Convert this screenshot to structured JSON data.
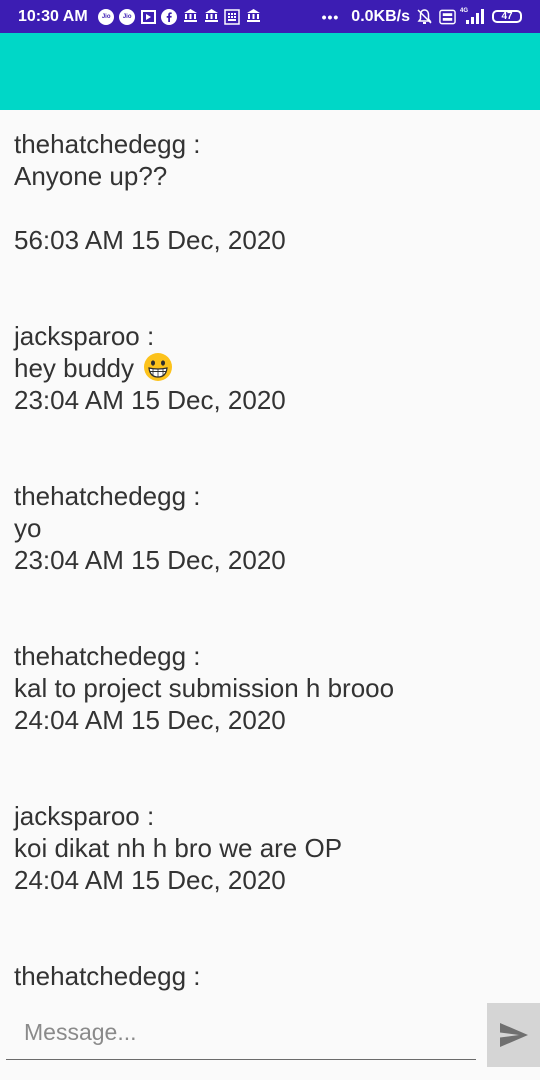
{
  "status_bar": {
    "time": "10:30 AM",
    "network_speed": "0.0KB/s",
    "battery_level": "47",
    "network_type": "4G",
    "left_icons": [
      "jio-icon",
      "jio-icon",
      "video-player-icon",
      "facebook-icon",
      "bank-app-icon",
      "bank-app-icon",
      "calculator-icon",
      "bank-app-icon"
    ],
    "right_icons": [
      "more-dots-icon",
      "mute-bell-icon",
      "volte-icon",
      "signal-icon",
      "battery-icon"
    ],
    "jio_label": "Jio",
    "bank_label": "₹"
  },
  "app_bar": {
    "background": "#00d7c7"
  },
  "messages": [
    {
      "sender": "thehatchedegg :",
      "text": "Anyone up??",
      "time": "56:03 AM 15 Dec, 2020",
      "extra_blank_line": true
    },
    {
      "sender": "jacksparoo :",
      "text": "hey buddy",
      "emoji": "grinning-face-icon",
      "time": "23:04 AM 15 Dec, 2020"
    },
    {
      "sender": "thehatchedegg :",
      "text": "yo",
      "time": "23:04 AM 15 Dec, 2020"
    },
    {
      "sender": "thehatchedegg :",
      "text": "kal to project submission h brooo",
      "time": "24:04 AM 15 Dec, 2020"
    },
    {
      "sender": "jacksparoo :",
      "text": "koi dikat nh h bro we are OP",
      "time": "24:04 AM 15 Dec, 2020"
    },
    {
      "sender": "thehatchedegg :",
      "text": "",
      "time": ""
    }
  ],
  "composer": {
    "placeholder": "Message...",
    "value": "",
    "send_icon": "send-icon"
  },
  "colors": {
    "status_bar": "#3c1db3",
    "app_bar": "#00d7c7",
    "background": "#fafafa",
    "send_button": "#d5d5d5",
    "send_icon": "#707070"
  }
}
